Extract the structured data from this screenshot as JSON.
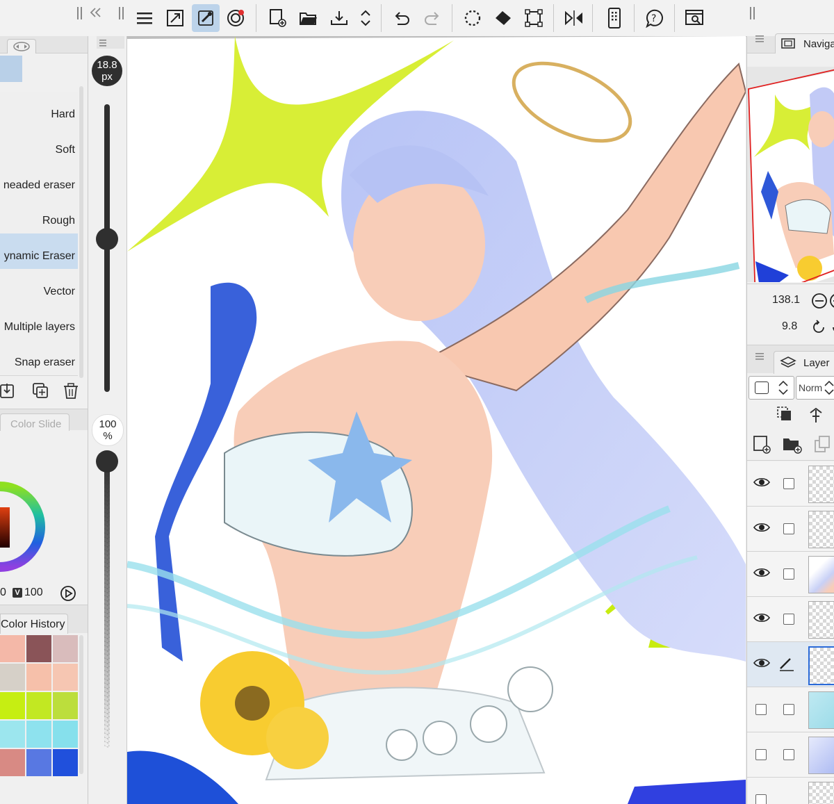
{
  "toolbar": {
    "buttons": [
      "menu-icon",
      "fit-icon",
      "eyedropper-icon",
      "snap-icon",
      "new-canvas-icon",
      "open-folder-icon",
      "save-icon",
      "reorder-icon",
      "undo-icon",
      "redo-icon",
      "selection-icon",
      "fill-icon",
      "transform-icon",
      "flip-icon",
      "phone-icon",
      "help-icon",
      "search-icon"
    ],
    "active": "eyedropper-icon"
  },
  "subtools": {
    "items": [
      "Hard",
      "Soft",
      "neaded eraser",
      "Rough",
      "ynamic Eraser",
      "Vector",
      "Multiple layers",
      "Snap eraser"
    ],
    "selected_index": 4
  },
  "brush": {
    "size_value": "18.8",
    "size_unit": "px",
    "opacity_value": "100",
    "opacity_unit": "%"
  },
  "color": {
    "tab_label": "Color Slide",
    "v_value_left": "0",
    "v_badge": "V",
    "v_value": "100",
    "history_label": "Color History",
    "history": [
      [
        "#f4b8a8",
        "#8a5458",
        "#d9bcbc"
      ],
      [
        "#d6d0c8",
        "#f6c0aa",
        "#f6c6b2"
      ],
      [
        "#c6ee12",
        "#c2e822",
        "#bcde3c"
      ],
      [
        "#9ce6ee",
        "#8ee2ee",
        "#86e0ec"
      ],
      [
        "#d88a84",
        "#5878e2",
        "#2050dc"
      ]
    ]
  },
  "navigator": {
    "title": "Naviga",
    "zoom": "138.1",
    "rotation": "9.8"
  },
  "layers": {
    "title": "Layer",
    "blend_mode": "Norm",
    "rows": [
      {
        "visible": true,
        "editing": false
      },
      {
        "visible": true,
        "editing": false
      },
      {
        "visible": true,
        "editing": false
      },
      {
        "visible": true,
        "editing": false
      },
      {
        "visible": true,
        "editing": true
      },
      {
        "visible": false,
        "editing": false
      },
      {
        "visible": false,
        "editing": false
      }
    ]
  },
  "colors": {
    "accent": "#bcd3ea",
    "selected_row": "#c9dcef",
    "panel_bg": "#f0f0f0",
    "navigator_frame": "#e02020"
  }
}
